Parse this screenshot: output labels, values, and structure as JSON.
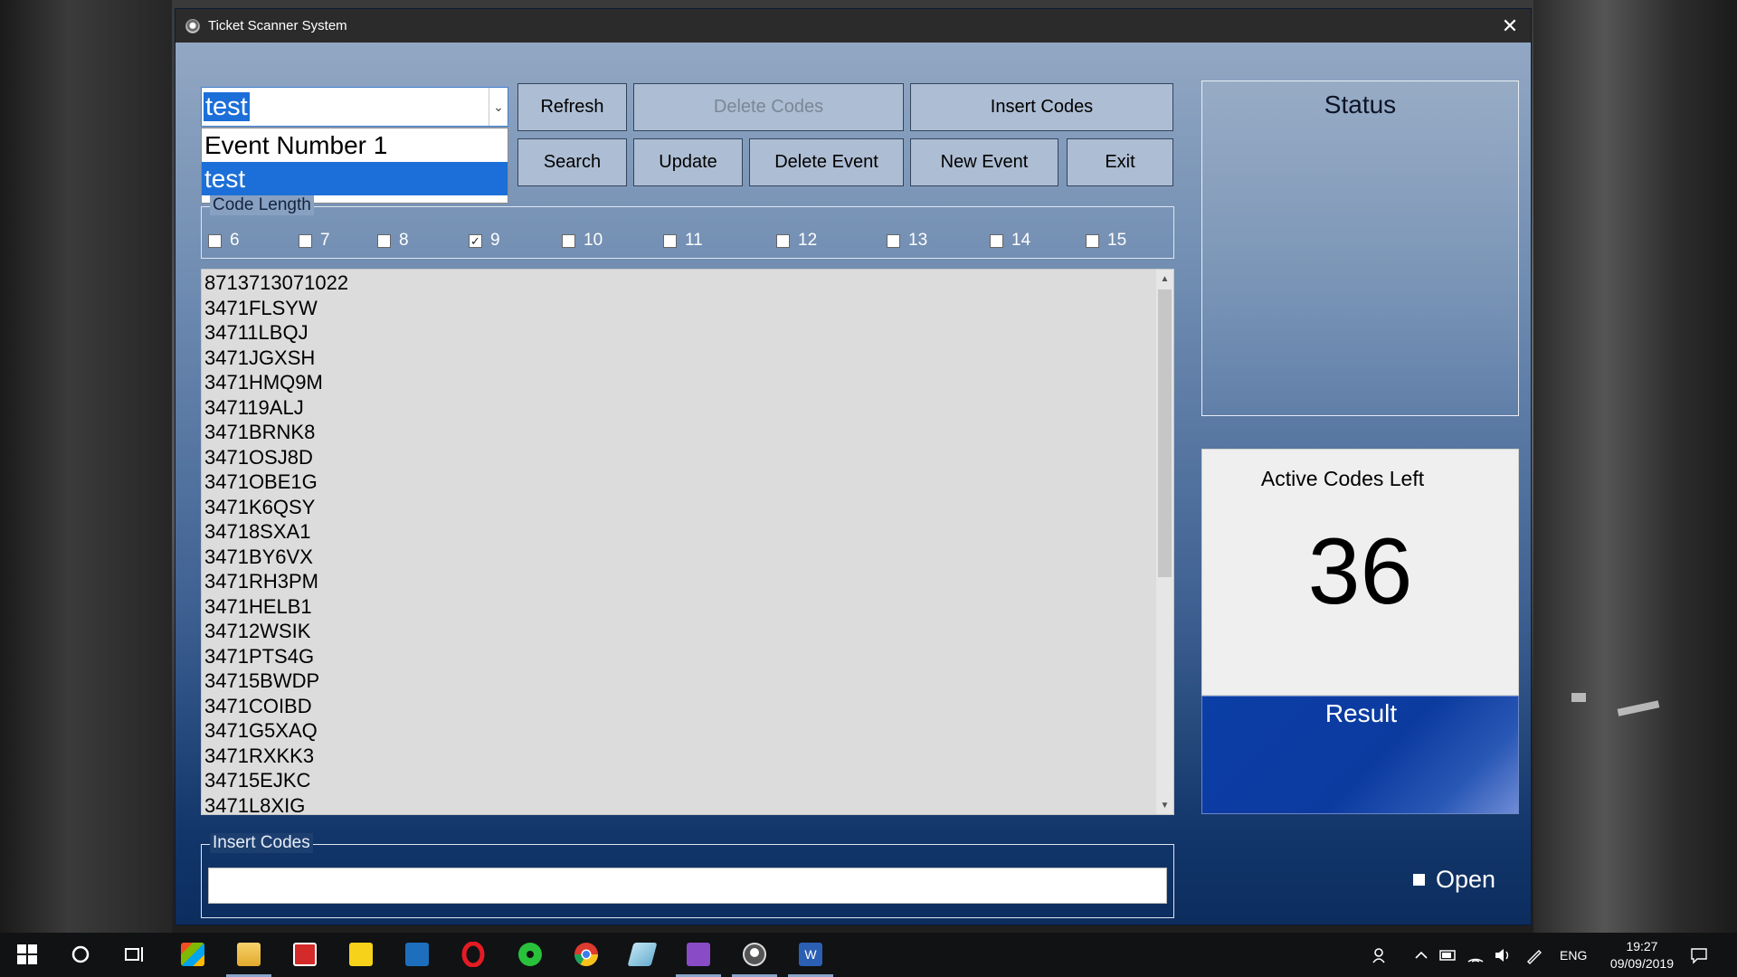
{
  "window": {
    "title": "Ticket Scanner System",
    "close_glyph": "✕"
  },
  "event_combo": {
    "value": "test",
    "options": [
      "Event Number 1",
      "test"
    ],
    "arrow_glyph": "⌄"
  },
  "buttons": {
    "refresh": "Refresh",
    "delete_codes": "Delete Codes",
    "insert_codes": "Insert Codes",
    "search": "Search",
    "update": "Update",
    "delete_event": "Delete Event",
    "new_event": "New Event",
    "exit": "Exit"
  },
  "code_length": {
    "label": "Code Length",
    "options": [
      {
        "label": "6",
        "checked": false
      },
      {
        "label": "7",
        "checked": false
      },
      {
        "label": "8",
        "checked": false
      },
      {
        "label": "9",
        "checked": true
      },
      {
        "label": "10",
        "checked": false
      },
      {
        "label": "11",
        "checked": false
      },
      {
        "label": "12",
        "checked": false
      },
      {
        "label": "13",
        "checked": false
      },
      {
        "label": "14",
        "checked": false
      },
      {
        "label": "15",
        "checked": false
      }
    ],
    "check_glyph": "✓"
  },
  "codes_list": [
    "8713713071022",
    "3471FLSYW",
    "34711LBQJ",
    "3471JGXSH",
    "3471HMQ9M",
    "347119ALJ",
    "3471BRNK8",
    "3471OSJ8D",
    "3471OBE1G",
    "3471K6QSY",
    "34718SXA1",
    "3471BY6VX",
    "3471RH3PM",
    "3471HELB1",
    "34712WSIK",
    "3471PTS4G",
    "34715BWDP",
    "3471COIBD",
    "3471G5XAQ",
    "3471RXKK3",
    "34715EJKC",
    "3471L8XIG"
  ],
  "scrollbar": {
    "up_glyph": "▲",
    "down_glyph": "▼"
  },
  "insert_codes_group": {
    "label": "Insert Codes",
    "input_value": ""
  },
  "status": {
    "title": "Status"
  },
  "active_codes": {
    "title": "Active Codes Left",
    "count": "36"
  },
  "result": {
    "title": "Result"
  },
  "open_toggle": {
    "label": "Open",
    "checked": false
  },
  "taskbar": {
    "tray_language": "ENG",
    "time": "19:27",
    "date": "09/09/2019",
    "icons": [
      "windows-start-icon",
      "cortana-circle-icon",
      "task-view-icon",
      "store-icon",
      "file-explorer-icon",
      "gift-icon",
      "sticky-notes-icon",
      "outlook-icon",
      "opera-icon",
      "spotify-like-icon",
      "chrome-icon",
      "app-icon",
      "visual-studio-icon",
      "ticket-scanner-app-icon",
      "word-icon"
    ]
  },
  "colors": {
    "accent_selection": "#1c6fd8",
    "result_blue": "#0b3ea6",
    "button_face": "#adbdd3"
  }
}
